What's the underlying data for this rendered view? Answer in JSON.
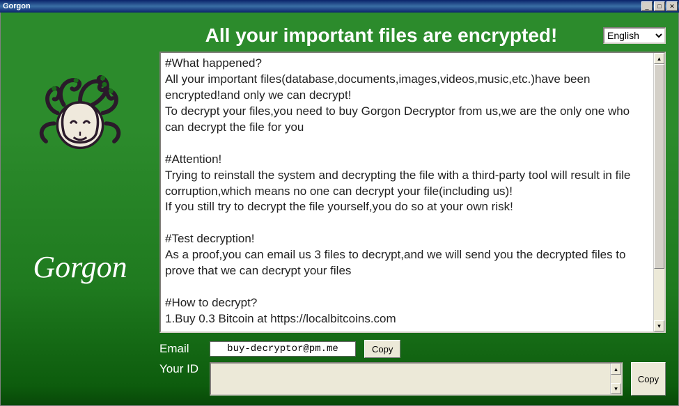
{
  "window": {
    "title": "Gorgon"
  },
  "header": {
    "heading": "All your important files are encrypted!",
    "language_options": [
      "English"
    ],
    "language_selected": "English"
  },
  "brand": {
    "name": "Gorgon",
    "logo_alt": "medusa-head"
  },
  "message": "#What happened?\nAll your important files(database,documents,images,videos,music,etc.)have been encrypted!and only we can decrypt!\nTo decrypt your files,you need to buy Gorgon Decryptor from us,we are the only one who can decrypt the file for you\n\n#Attention!\nTrying to reinstall the system and decrypting the file with a third-party tool will result in file corruption,which means no one can decrypt your file(including us)!\nIf you still try to decrypt the file yourself,you do so at your own risk!\n\n#Test decryption!\nAs a proof,you can email us 3 files to decrypt,and we will send you the decrypted files to prove that we can decrypt your files\n\n#How to decrypt?\n1.Buy 0.3 Bitcoin at https://localbitcoins.com",
  "fields": {
    "email_label": "Email",
    "email_value": "buy-decryptor@pm.me",
    "yourid_label": "Your ID",
    "yourid_value": "",
    "copy_label": "Copy"
  },
  "icons": {
    "minimize": "_",
    "maximize": "□",
    "close": "✕",
    "scroll_up": "▴",
    "scroll_down": "▾"
  }
}
